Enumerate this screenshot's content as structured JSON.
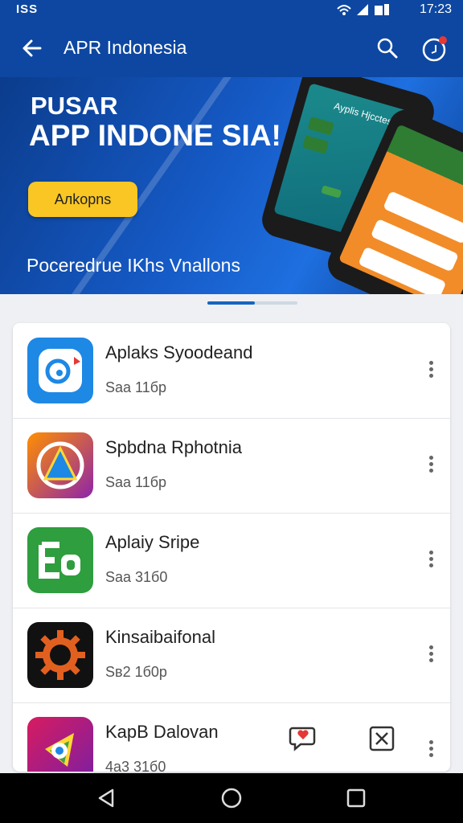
{
  "status_bar": {
    "carrier": "ISS",
    "time": "17:23"
  },
  "app_bar": {
    "title": "APR Indonesia"
  },
  "banner": {
    "kicker": "PUSAR",
    "headline": "APP INDONE SIA!",
    "cta_label": "Aлkopns",
    "caption": "Poceredrue IKhs Vnallons",
    "phone_screen_title": "Ayplis Hjcctes"
  },
  "carousel": {
    "active_fraction": 0.53
  },
  "apps": [
    {
      "name": "Aplaks Syoodeand",
      "meta": "Saа 11бp",
      "icon": "blue-cloud-icon"
    },
    {
      "name": "Spbdna Rphotnia",
      "meta": "Saа 11бp",
      "icon": "triangle-ring-icon"
    },
    {
      "name": "Aplaiy Sripе",
      "meta": "Saa 31б0",
      "icon": "green-eb-icon"
    },
    {
      "name": "Kinsaibaifonal",
      "meta": "Sв2 1б0p",
      "icon": "orange-gear-icon"
    },
    {
      "name": "KapB Dalovan",
      "meta": "4а3 31б0",
      "icon": "colorful-logo-icon"
    }
  ],
  "colors": {
    "primary": "#0d47a1",
    "accent": "#f9c623",
    "nav": "#000000"
  }
}
